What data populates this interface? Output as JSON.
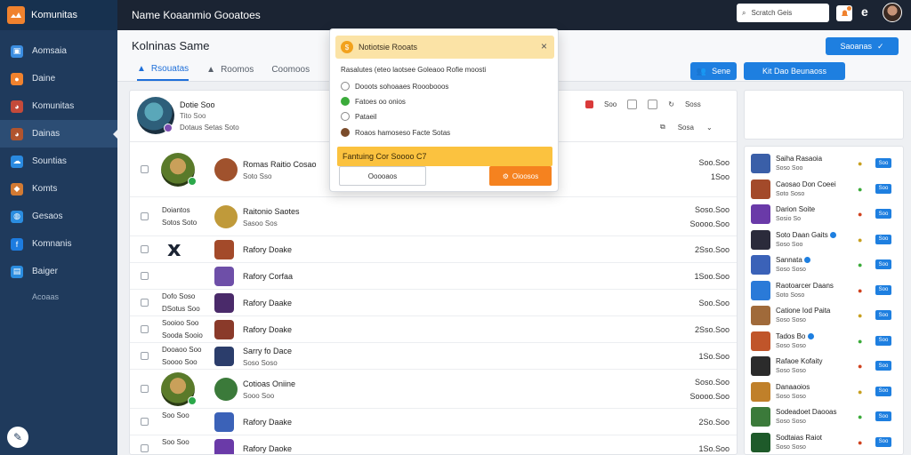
{
  "app": {
    "brand": "Komunitas"
  },
  "sidebar": {
    "items": [
      {
        "label": "Aomsaia",
        "icon": "window-icon",
        "color": "#3b8de0"
      },
      {
        "label": "Daine",
        "icon": "flame-icon",
        "color": "#f0822e"
      },
      {
        "label": "Komunitas",
        "icon": "avatar-icon",
        "color": "#c44a3a"
      },
      {
        "label": "Dainas",
        "icon": "avatar-icon",
        "color": "#b0542e"
      },
      {
        "label": "Sountias",
        "icon": "cloud-icon",
        "color": "#2a8ae0"
      },
      {
        "label": "Komts",
        "icon": "character-icon",
        "color": "#d27a33"
      },
      {
        "label": "Gesaos",
        "icon": "globe-icon",
        "color": "#2b8de0"
      },
      {
        "label": "Komnanis",
        "icon": "f-icon",
        "color": "#1d7ce0"
      },
      {
        "label": "Baiger",
        "icon": "share-icon",
        "color": "#2b8de0"
      }
    ],
    "more_label": "Acoaas"
  },
  "topbar": {
    "title": "Name Koaanmio Gooatoes",
    "search_placeholder": "Scratch Geis",
    "user_initial": "e"
  },
  "page": {
    "title": "Kolninas Same",
    "tabs": [
      {
        "label": "Rsouatas",
        "active": true
      },
      {
        "label": "Roomos",
        "active": false
      },
      {
        "label": "Coomoos",
        "active": false
      }
    ],
    "header_button": "Saoanas",
    "btn_small": "Sene",
    "btn_wide": "Kit Dao Beunaoss"
  },
  "profile": {
    "name": "Dotie Soo",
    "sub": "Tito Soo",
    "meta": "Dotaus Setas Soto",
    "actions": [
      "Soo",
      "Soss"
    ],
    "footer": "Sosa"
  },
  "rows": [
    {
      "lead_name": "",
      "title": "Romas Raitio Cosao",
      "sub": "Soto Sso",
      "value": "Soo.Soo",
      "value2": "1Soo"
    },
    {
      "lead_name": "Doiantos\nSotos Soto",
      "title": "Raitonio Saotes",
      "sub": "Sasoo Sos",
      "value": "Soso.Soo",
      "value2": "Soooo.Soo"
    },
    {
      "lead_name": "",
      "title": "Rafory Doake",
      "sub": "",
      "value": "2Sso.Soo",
      "value2": ""
    },
    {
      "lead_name": "",
      "title": "Rafory Corfaa",
      "sub": "",
      "value": "1Soo.Soo",
      "value2": ""
    },
    {
      "lead_name": "Dofo Soso\nDSotus Soo",
      "title": "Rafory Daake",
      "sub": "",
      "value": "Soo.Soo",
      "value2": ""
    },
    {
      "lead_name": "Sooioo Soo\nSooda Sooio",
      "title": "Rafory Doake",
      "sub": "",
      "value": "2Sso.Soo",
      "value2": ""
    },
    {
      "lead_name": "Dooaoo Soo\nSoooo Soo",
      "title": "Sarry fo Dace",
      "sub": "Soso Soso",
      "value": "1So.Soo",
      "value2": ""
    },
    {
      "lead_name": "",
      "title": "Cotioas Oniine",
      "sub": "Sooo Soo",
      "value": "Soso.Soo",
      "value2": "Soooo.Soo"
    },
    {
      "lead_name": "Soo Soo",
      "title": "Rafory Daake",
      "sub": "",
      "value": "2So.Soo",
      "value2": ""
    },
    {
      "lead_name": "Soo Soo",
      "title": "Rafory Daoke",
      "sub": "",
      "value": "1So.Soo",
      "value2": ""
    }
  ],
  "right_list": [
    {
      "title": "Saiha Rasaoia",
      "sub": "Soso Soo",
      "icon": "●"
    },
    {
      "title": "Caosao Don Coeei",
      "sub": "Soto Soso",
      "icon": "●"
    },
    {
      "title": "Darion Soite",
      "sub": "Sosio So",
      "icon": "●"
    },
    {
      "title": "Soto Daan Gaits",
      "sub": "Soso Soo",
      "icon": "●",
      "verified": true
    },
    {
      "title": "Sannata",
      "sub": "Soso Soso",
      "icon": "●",
      "verified": true
    },
    {
      "title": "Raotoarcer Daans",
      "sub": "Soto Soso",
      "icon": "●"
    },
    {
      "title": "Catione Iod Paita",
      "sub": "Soso Soso",
      "icon": "●"
    },
    {
      "title": "Tados Bo",
      "sub": "Soso Soso",
      "icon": "●",
      "verified": true
    },
    {
      "title": "Rafaoe Kofaity",
      "sub": "Soso Soso",
      "icon": "●"
    },
    {
      "title": "Danaaoios",
      "sub": "Soso Soso",
      "icon": "●"
    },
    {
      "title": "Sodeadoet Daooas",
      "sub": "Soso Soso",
      "icon": "●"
    },
    {
      "title": "Sodtaias Raiot",
      "sub": "Soso Soso",
      "icon": "●"
    }
  ],
  "right_button_label": "Soo",
  "popup": {
    "title": "Notiotsie Rooats",
    "close": "×",
    "description": "Rasalutes (eteo laotsee Goleaoo Rofie moosti",
    "options": [
      {
        "label": "Dooots sohoaaes Rooobooos",
        "dot_color": "#ffffff"
      },
      {
        "label": "Fatoes oo onios",
        "dot_color": "#3bab3a"
      },
      {
        "label": "Pataeil",
        "dot_color": "#ffffff"
      },
      {
        "label": "Roaos hamoseso Facte Sotas",
        "dot_color": "#7a4b2a"
      }
    ],
    "highlight": "Fantuing Cor Soooo C7",
    "cancel": "Ooooaos",
    "confirm": "Oioosos"
  }
}
